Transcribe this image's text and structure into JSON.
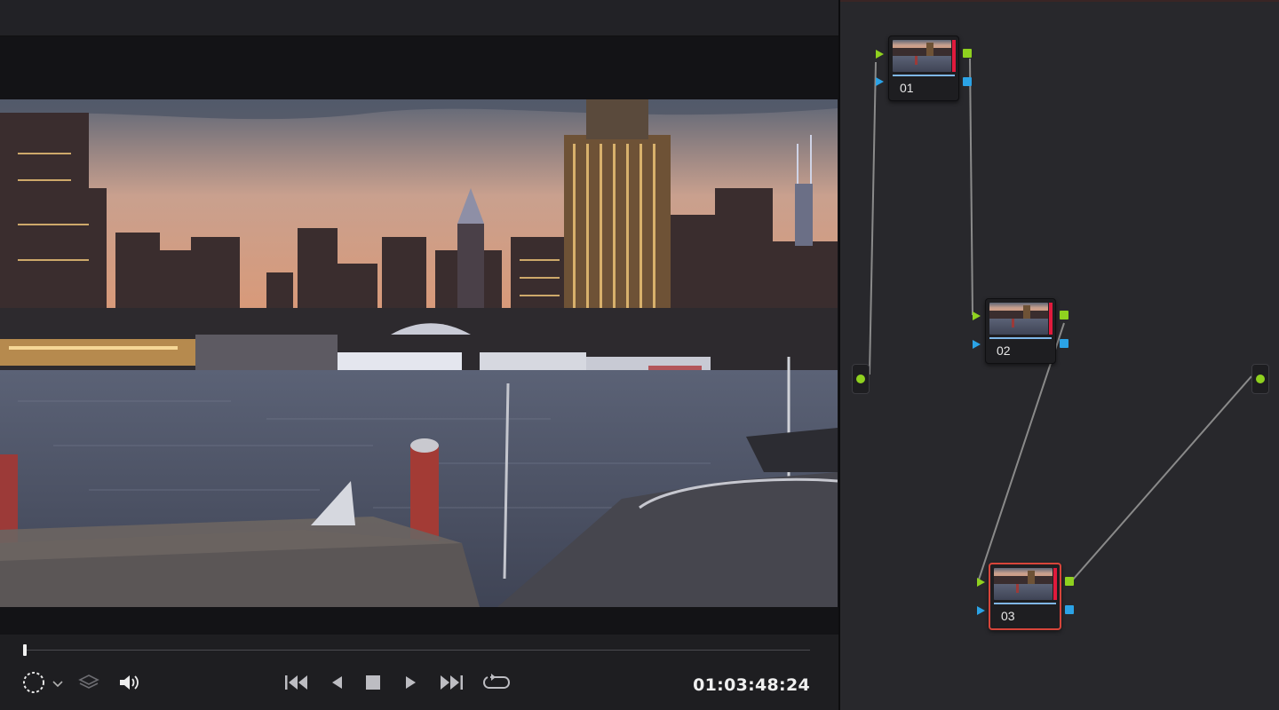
{
  "colors": {
    "rgb_port": "#8fd11f",
    "key_port": "#2ba3e6",
    "selected_node": "#d8453a",
    "node_marker": "#e01a3c",
    "connection": "#8a8a8a"
  },
  "viewer": {
    "playhead_progress": 0.0,
    "timecode": "01:03:48:24",
    "icons": {
      "qualifier": "dashed-circle-icon",
      "dropdown": "chevron-down-icon",
      "layers": "layers-icon",
      "audio": "speaker-icon",
      "first": "skip-to-start-icon",
      "back": "play-reverse-icon",
      "stop": "stop-icon",
      "play": "play-icon",
      "last": "skip-to-end-icon",
      "loop": "loop-icon"
    }
  },
  "node_graph": {
    "nodes": [
      {
        "label": "01",
        "selected": false
      },
      {
        "label": "02",
        "selected": false
      },
      {
        "label": "03",
        "selected": true
      }
    ]
  }
}
